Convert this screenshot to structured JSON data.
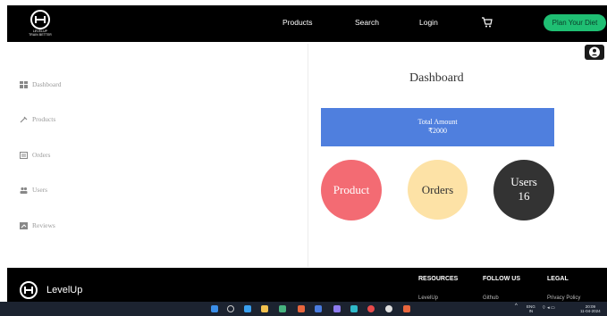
{
  "header": {
    "logo_text": "LEVELUP",
    "logo_subtext": "TRAIN BETTER",
    "nav": [
      "Products",
      "Search",
      "Login"
    ],
    "cart_icon": "cart-icon",
    "cta_label": "Plan Your Diet",
    "cta_color": "#1fbf73"
  },
  "sidebar": {
    "items": [
      {
        "label": "Dashboard",
        "icon": "dashboard-icon"
      },
      {
        "label": "Products",
        "icon": "products-icon"
      },
      {
        "label": "Orders",
        "icon": "orders-icon"
      },
      {
        "label": "Users",
        "icon": "users-icon"
      },
      {
        "label": "Reviews",
        "icon": "reviews-icon"
      }
    ]
  },
  "main": {
    "title": "Dashboard",
    "total_label": "Total Amount",
    "total_value": "₹2000",
    "total_color": "#4f7fde",
    "circles": [
      {
        "label": "Product",
        "value": "",
        "color": "#f36b73"
      },
      {
        "label": "Orders",
        "value": "",
        "color": "#fde2a6"
      },
      {
        "label": "Users",
        "value": "16",
        "color": "#333333"
      }
    ]
  },
  "footer": {
    "brand": "LevelUp",
    "columns": [
      {
        "title": "RESOURCES",
        "link": "LevelUp"
      },
      {
        "title": "FOLLOW US",
        "link": "Github"
      },
      {
        "title": "LEGAL",
        "link": "Privacy Policy"
      }
    ]
  },
  "taskbar": {
    "lang_top": "ENG",
    "lang_bottom": "IN",
    "time": "20:09",
    "date": "11-04-2024"
  }
}
